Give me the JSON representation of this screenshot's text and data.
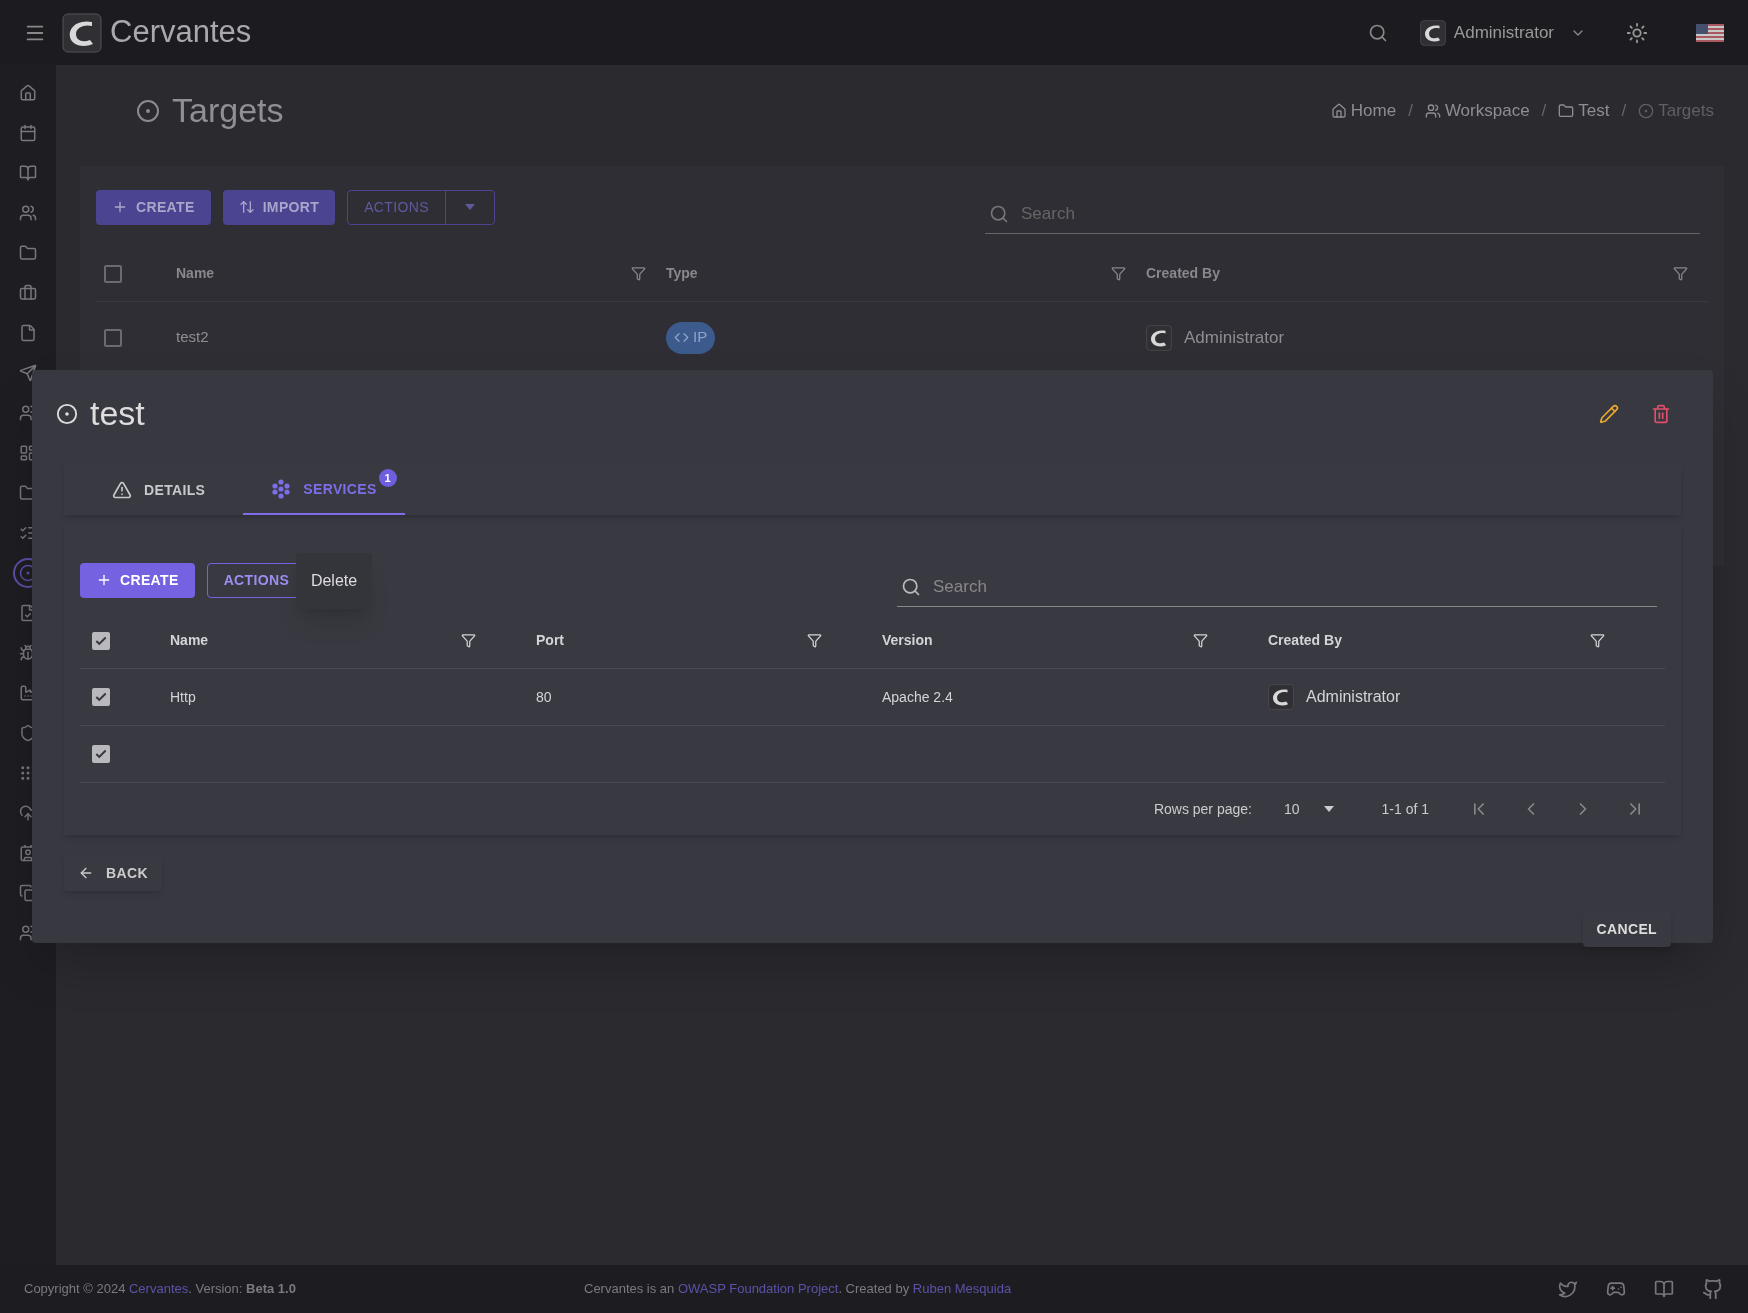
{
  "app": {
    "title": "Cervantes"
  },
  "topbar": {
    "user": "Administrator"
  },
  "sidebar": {
    "items": [
      {
        "selected": false
      },
      {
        "selected": false
      },
      {
        "selected": false
      },
      {
        "selected": false
      },
      {
        "selected": false
      },
      {
        "selected": false
      },
      {
        "selected": false
      },
      {
        "selected": false
      },
      {
        "selected": false
      },
      {
        "selected": false
      },
      {
        "selected": false
      },
      {
        "selected": false
      },
      {
        "selected": true
      },
      {
        "selected": false
      },
      {
        "selected": false
      },
      {
        "selected": false
      },
      {
        "selected": false
      },
      {
        "selected": false
      },
      {
        "selected": false
      },
      {
        "selected": false
      },
      {
        "selected": false
      },
      {
        "selected": false
      }
    ]
  },
  "page": {
    "title": "Targets",
    "breadcrumbs": [
      {
        "label": "Home",
        "current": false
      },
      {
        "separator": "/",
        "label": "Workspace",
        "current": false
      },
      {
        "separator": "/",
        "label": "Test",
        "current": false
      },
      {
        "separator": "/",
        "label": "Targets",
        "current": true
      }
    ]
  },
  "toolbar": {
    "create": "CREATE",
    "import": "IMPORT",
    "actions": "ACTIONS",
    "search_placeholder": "Search"
  },
  "table": {
    "all_checked": false,
    "columns": [
      "Name",
      "Type",
      "Created By"
    ],
    "rows": [
      {
        "checked": false,
        "name": "test2",
        "type": "IP",
        "created_by": "Administrator"
      }
    ]
  },
  "dialog": {
    "title": "test",
    "tabs": [
      {
        "label": "DETAILS",
        "selected": false
      },
      {
        "label": "SERVICES",
        "selected": true,
        "badge": "1"
      }
    ],
    "toolbar": {
      "create": "CREATE",
      "actions": "ACTIONS",
      "search_placeholder": "Search",
      "menu": [
        "Delete"
      ]
    },
    "table": {
      "all_checked": true,
      "columns": [
        "Name",
        "Port",
        "Version",
        "Created By"
      ],
      "rows": [
        {
          "checked": true,
          "name": "Http",
          "port": "80",
          "version": "Apache 2.4",
          "created_by": "Administrator"
        },
        {
          "checked": true
        }
      ]
    },
    "pagination": {
      "rows_per_page_label": "Rows per page:",
      "rows_per_page": "10",
      "range": "1-1 of 1"
    },
    "back": "BACK",
    "cancel": "CANCEL"
  },
  "footer": {
    "copyright": "Copyright © 2024",
    "copyright_link": "Cervantes",
    "version_label": ". Version:",
    "version": "Beta 1.0",
    "about_prefix": "Cervantes is an",
    "about_link": "OWASP Foundation Project",
    "about_middle": ". Created by",
    "author_link": "Ruben Mesquida"
  }
}
